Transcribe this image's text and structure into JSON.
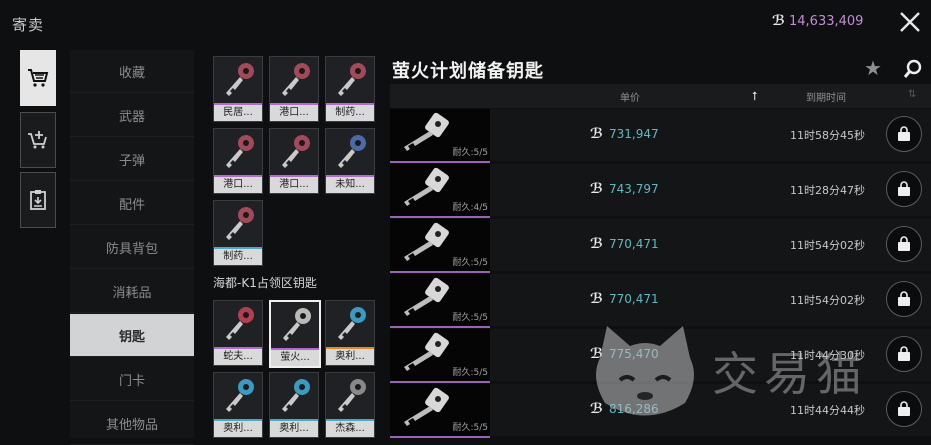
{
  "window": {
    "title": "寄卖",
    "currency_value": "14,633,409"
  },
  "rail_tabs": [
    {
      "name": "buy-tab",
      "icon": "cart-icon"
    },
    {
      "name": "sell-tab",
      "icon": "cart-add-icon"
    },
    {
      "name": "records-tab",
      "icon": "clipboard-icon"
    }
  ],
  "categories": [
    "收藏",
    "武器",
    "子弹",
    "配件",
    "防具背包",
    "消耗品",
    "钥匙",
    "门卡",
    "其他物品"
  ],
  "active_category": "钥匙",
  "grid_top": [
    {
      "label": "民居...",
      "color": "#a24a5a",
      "bar": "#b06ad0"
    },
    {
      "label": "港口...",
      "color": "#a24a5a",
      "bar": "#b06ad0"
    },
    {
      "label": "制药...",
      "color": "#a24a5a",
      "bar": "#b06ad0"
    },
    {
      "label": "港口...",
      "color": "#a24a5a",
      "bar": "#b06ad0"
    },
    {
      "label": "港口...",
      "color": "#a24a5a",
      "bar": "#b06ad0"
    },
    {
      "label": "未知...",
      "color": "#4a6aa8",
      "bar": "#b06ad0"
    },
    {
      "label": "制药...",
      "color": "#a24a5a",
      "bar": "#4aa8c8"
    }
  ],
  "section_title": "海都-K1占领区钥匙",
  "grid_bottom": [
    {
      "label": "蛇夫...",
      "color": "#b04050",
      "bar": "#b06ad0"
    },
    {
      "label": "萤火...",
      "color": "#b9b9b9",
      "bar": "#b06ad0"
    },
    {
      "label": "奥利...",
      "color": "#3a9ac0",
      "bar": "#e08a2a"
    },
    {
      "label": "奥利...",
      "color": "#3a9ac0",
      "bar": "#4aa8c8"
    },
    {
      "label": "奥利...",
      "color": "#3a9ac0",
      "bar": "#4aa8c8"
    },
    {
      "label": "杰森...",
      "color": "#888888",
      "bar": "#4aa8c8"
    }
  ],
  "listing": {
    "title": "萤火计划储备钥匙",
    "col_price": "单价",
    "col_expire": "到期时间",
    "rows": [
      {
        "durability": "耐久:5/5",
        "price": "731,947",
        "time": "11时58分45秒"
      },
      {
        "durability": "耐久:4/5",
        "price": "743,797",
        "time": "11时28分47秒"
      },
      {
        "durability": "耐久:5/5",
        "price": "770,471",
        "time": "11时54分02秒"
      },
      {
        "durability": "耐久:5/5",
        "price": "770,471",
        "time": "11时54分02秒"
      },
      {
        "durability": "耐久:5/5",
        "price": "775,470",
        "time": "11时44分30秒"
      },
      {
        "durability": "耐久:5/5",
        "price": "816,286",
        "time": "11时44分44秒"
      }
    ]
  },
  "watermark": "交易猫"
}
